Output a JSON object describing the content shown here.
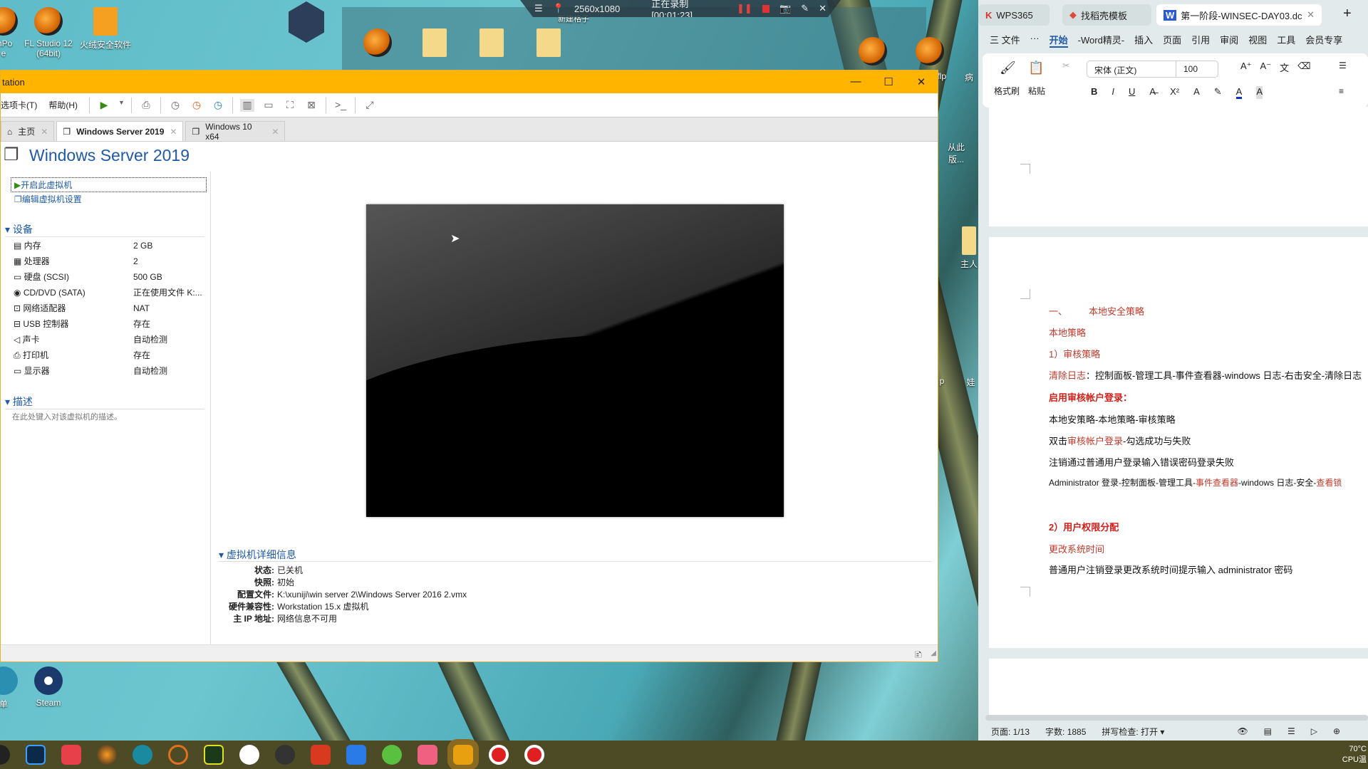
{
  "desktop": {
    "icons": [
      "mPo\ne",
      "FL Studio 12\n(64bit)",
      "火绒安全软件",
      "新建格子",
      "Steam",
      "单",
      ".flp",
      "病",
      "从此\n版...",
      "主人",
      "p",
      "娃"
    ]
  },
  "recorder": {
    "resolution": "2560x1080",
    "status": "正在录制 [00:01:23]"
  },
  "vmware": {
    "title": "tation",
    "menu": [
      "选项卡(T)",
      "帮助(H)"
    ],
    "tabs": [
      {
        "label": "主页"
      },
      {
        "label": "Windows Server 2019"
      },
      {
        "label": "Windows 10 x64"
      }
    ],
    "vm_name": "Windows Server 2019",
    "actions": [
      "开启此虚拟机",
      "编辑虚拟机设置"
    ],
    "devices_title": "设备",
    "devices": [
      [
        "内存",
        "2 GB"
      ],
      [
        "处理器",
        "2"
      ],
      [
        "硬盘 (SCSI)",
        "500 GB"
      ],
      [
        "CD/DVD (SATA)",
        "正在使用文件 K:..."
      ],
      [
        "网络适配器",
        "NAT"
      ],
      [
        "USB 控制器",
        "存在"
      ],
      [
        "声卡",
        "自动检测"
      ],
      [
        "打印机",
        "存在"
      ],
      [
        "显示器",
        "自动检测"
      ]
    ],
    "desc_title": "描述",
    "desc_placeholder": "在此处键入对该虚拟机的描述。",
    "details_title": "虚拟机详细信息",
    "details": [
      [
        "状态:",
        "已关机"
      ],
      [
        "快照:",
        "初始"
      ],
      [
        "配置文件:",
        "K:\\xuniji\\win server 2\\Windows Server 2016 2.vmx"
      ],
      [
        "硬件兼容性:",
        "Workstation 15.x 虚拟机"
      ],
      [
        "主 IP 地址:",
        "网络信息不可用"
      ]
    ]
  },
  "wps": {
    "tabs": [
      "WPS365",
      "找稻壳模板",
      "第一阶段-WINSEC-DAY03.dc"
    ],
    "menu": [
      "三 文件",
      "···",
      "开始",
      "-Word精灵-",
      "插入",
      "页面",
      "引用",
      "审阅",
      "视图",
      "工具",
      "会员专享"
    ],
    "font": "宋体 (正文)",
    "size": "100",
    "ribbon_labels": [
      "格式刷",
      "粘贴"
    ],
    "doc": {
      "l1a": "一、",
      "l1b": "本地安全策略",
      "l2": "本地策略",
      "l3": "1）审核策略",
      "l4a": "清除日志",
      "l4b": "：控制面板-管理工具-事件查看器-windows 日志-右击安全-清除日志",
      "l5": "启用审核帐户登录：",
      "l6": "本地安策略-本地策略-审核策略",
      "l7a": "双击",
      "l7b": "审核帐户登录",
      "l7c": "-勾选成功与失败",
      "l8": "注销通过普通用户登录输入错误密码登录失败",
      "l9a": "Administrator 登录-控制面板-管理工具-",
      "l9b": "事件查看器",
      "l9c": "-windows 日志-安全-",
      "l9d": "查看锁",
      "l10": "2）用户权限分配",
      "l11": "更改系统时间",
      "l12": "普通用户注销登录更改系统时间提示输入 administrator 密码"
    },
    "status": {
      "page": "页面: 1/13",
      "words": "字数: 1885",
      "spell": "拼写检查: 打开"
    }
  },
  "tray": {
    "temp": "70°C",
    "cpu": "CPU温"
  }
}
